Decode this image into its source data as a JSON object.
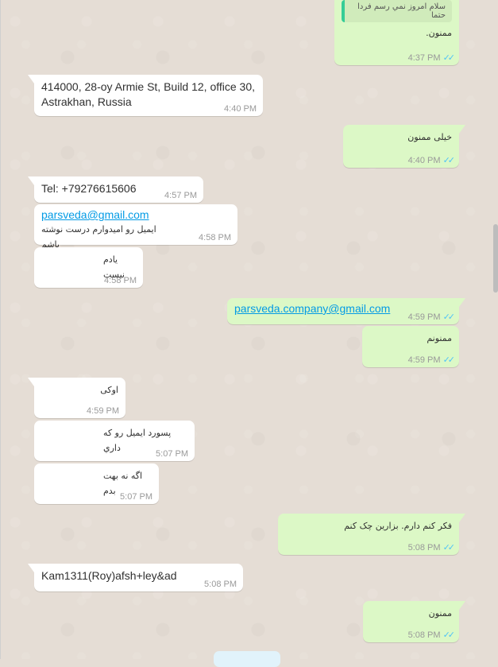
{
  "messages": [
    {
      "id": "m1",
      "dir": "out",
      "quote": "سلام امروز نمي رسم فردا حتما",
      "text": "ممنون.",
      "time": "4:37 PM",
      "ticks": "✓✓"
    },
    {
      "id": "m2",
      "dir": "in",
      "text": "414000, 28-oy Armie St, Build 12, office 30,\nAstrakhan, Russia",
      "time": "4:40 PM"
    },
    {
      "id": "m3",
      "dir": "out",
      "text": "خیلی ممنون",
      "time": "4:40 PM",
      "ticks": "✓✓"
    },
    {
      "id": "m4",
      "dir": "in",
      "text": "Tel: +79276615606",
      "time": "4:57 PM"
    },
    {
      "id": "m5",
      "dir": "in",
      "link": "parsveda@gmail.com",
      "text": "ایمیل رو امیدوارم درست نوشته باشم",
      "time": "4:58 PM"
    },
    {
      "id": "m6",
      "dir": "in",
      "text": "یادم نیست",
      "time": "4:58 PM"
    },
    {
      "id": "m7",
      "dir": "out",
      "link": "parsveda.company@gmail.com",
      "time": "4:59 PM",
      "ticks": "✓✓"
    },
    {
      "id": "m8",
      "dir": "out",
      "text": "ممنونم",
      "time": "4:59 PM",
      "ticks": "✓✓"
    },
    {
      "id": "m9",
      "dir": "in",
      "text": "اوکی",
      "time": "4:59 PM"
    },
    {
      "id": "m10",
      "dir": "in",
      "text": "پسورد ایمیل رو که داري",
      "time": "5:07 PM"
    },
    {
      "id": "m11",
      "dir": "in",
      "text": "اگه نه بهت بدم",
      "time": "5:07 PM"
    },
    {
      "id": "m12",
      "dir": "out",
      "text": "فکر کنم دارم. بزارین چک کنم",
      "time": "5:08 PM",
      "ticks": "✓✓"
    },
    {
      "id": "m13",
      "dir": "in",
      "text": "Kam1311(Roy)afsh+ley&ad",
      "time": "5:08 PM"
    },
    {
      "id": "m14",
      "dir": "out",
      "text": "ممنون",
      "time": "5:08 PM",
      "ticks": "✓✓"
    }
  ],
  "colors": {
    "incoming": "#ffffff",
    "outgoing": "#dcf8c6",
    "read_ticks": "#4fc3f7",
    "background": "#e5ddd5"
  }
}
